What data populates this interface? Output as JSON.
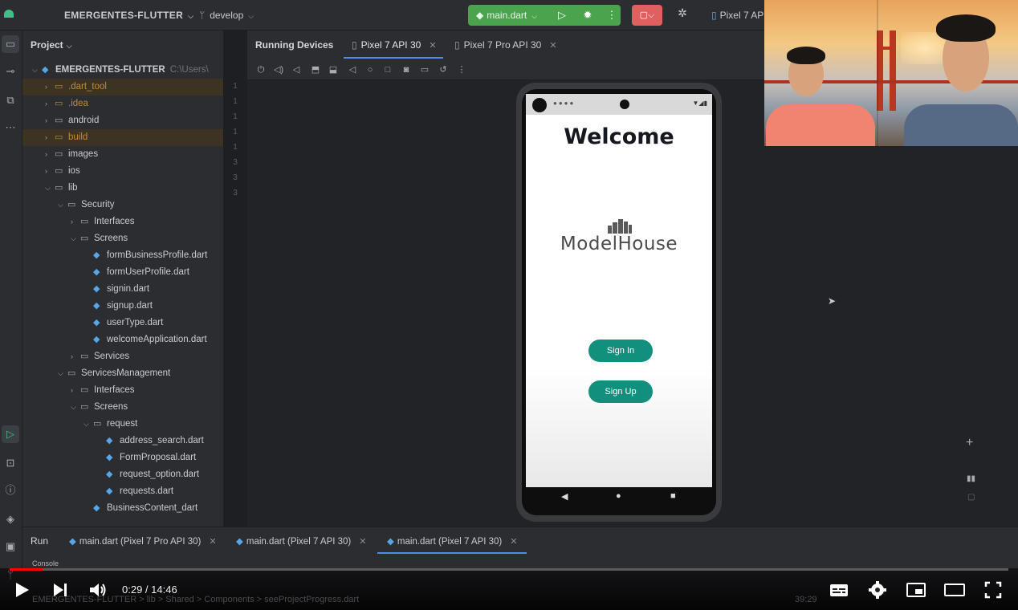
{
  "titlebar": {
    "project_name": "EMERGENTES-FLUTTER",
    "branch": "develop",
    "run_config": "main.dart",
    "device": "Pixel 7 API"
  },
  "project_panel": {
    "header": "Project",
    "root_name": "EMERGENTES-FLUTTER",
    "root_path": "C:\\Users\\",
    "items": [
      {
        "label": ".dart_tool",
        "depth": 1,
        "type": "folder",
        "expanded": false,
        "highlight": true,
        "orange": true
      },
      {
        "label": ".idea",
        "depth": 1,
        "type": "folder",
        "expanded": false,
        "highlight": false,
        "orange": true
      },
      {
        "label": "android",
        "depth": 1,
        "type": "folder",
        "expanded": false
      },
      {
        "label": "build",
        "depth": 1,
        "type": "folder",
        "expanded": false,
        "highlight": true,
        "orange": true
      },
      {
        "label": "images",
        "depth": 1,
        "type": "folder",
        "expanded": false
      },
      {
        "label": "ios",
        "depth": 1,
        "type": "folder",
        "expanded": false
      },
      {
        "label": "lib",
        "depth": 1,
        "type": "folder",
        "expanded": true
      },
      {
        "label": "Security",
        "depth": 2,
        "type": "folder",
        "expanded": true
      },
      {
        "label": "Interfaces",
        "depth": 3,
        "type": "folder",
        "expanded": false
      },
      {
        "label": "Screens",
        "depth": 3,
        "type": "folder",
        "expanded": true
      },
      {
        "label": "formBusinessProfile.dart",
        "depth": 4,
        "type": "dart"
      },
      {
        "label": "formUserProfile.dart",
        "depth": 4,
        "type": "dart"
      },
      {
        "label": "signin.dart",
        "depth": 4,
        "type": "dart"
      },
      {
        "label": "signup.dart",
        "depth": 4,
        "type": "dart"
      },
      {
        "label": "userType.dart",
        "depth": 4,
        "type": "dart"
      },
      {
        "label": "welcomeApplication.dart",
        "depth": 4,
        "type": "dart"
      },
      {
        "label": "Services",
        "depth": 3,
        "type": "folder",
        "expanded": false
      },
      {
        "label": "ServicesManagement",
        "depth": 2,
        "type": "folder",
        "expanded": true
      },
      {
        "label": "Interfaces",
        "depth": 3,
        "type": "folder",
        "expanded": false
      },
      {
        "label": "Screens",
        "depth": 3,
        "type": "folder",
        "expanded": true
      },
      {
        "label": "request",
        "depth": 4,
        "type": "folder",
        "expanded": true
      },
      {
        "label": "address_search.dart",
        "depth": 5,
        "type": "dart"
      },
      {
        "label": "FormProposal.dart",
        "depth": 5,
        "type": "dart"
      },
      {
        "label": "request_option.dart",
        "depth": 5,
        "type": "dart"
      },
      {
        "label": "requests.dart",
        "depth": 5,
        "type": "dart"
      },
      {
        "label": "BusinessContent_dart",
        "depth": 4,
        "type": "dart"
      }
    ]
  },
  "running_devices": {
    "title": "Running Devices",
    "tabs": [
      "Pixel 7 API 30",
      "Pixel 7 Pro API 30"
    ]
  },
  "app": {
    "welcome": "Welcome",
    "brand": "ModelHouse",
    "signin_label": "Sign In",
    "signup_label": "Sign Up",
    "accent": "#138f7e"
  },
  "run_panel": {
    "label": "Run",
    "tabs": [
      "main.dart (Pixel 7 Pro API 30)",
      "main.dart (Pixel 7 API 30)",
      "main.dart (Pixel 7 API 30)"
    ],
    "console": "Console"
  },
  "player": {
    "current": "0:29",
    "duration": "14:46",
    "time_text": "0:29 / 14:46",
    "progress": 0.033,
    "buffered": 0.028,
    "status_path": "EMERGENTES-FLUTTER  >  lib  >  Shared  >  Components  >  seeProjectProgress.dart",
    "status_pos": "39:29"
  }
}
